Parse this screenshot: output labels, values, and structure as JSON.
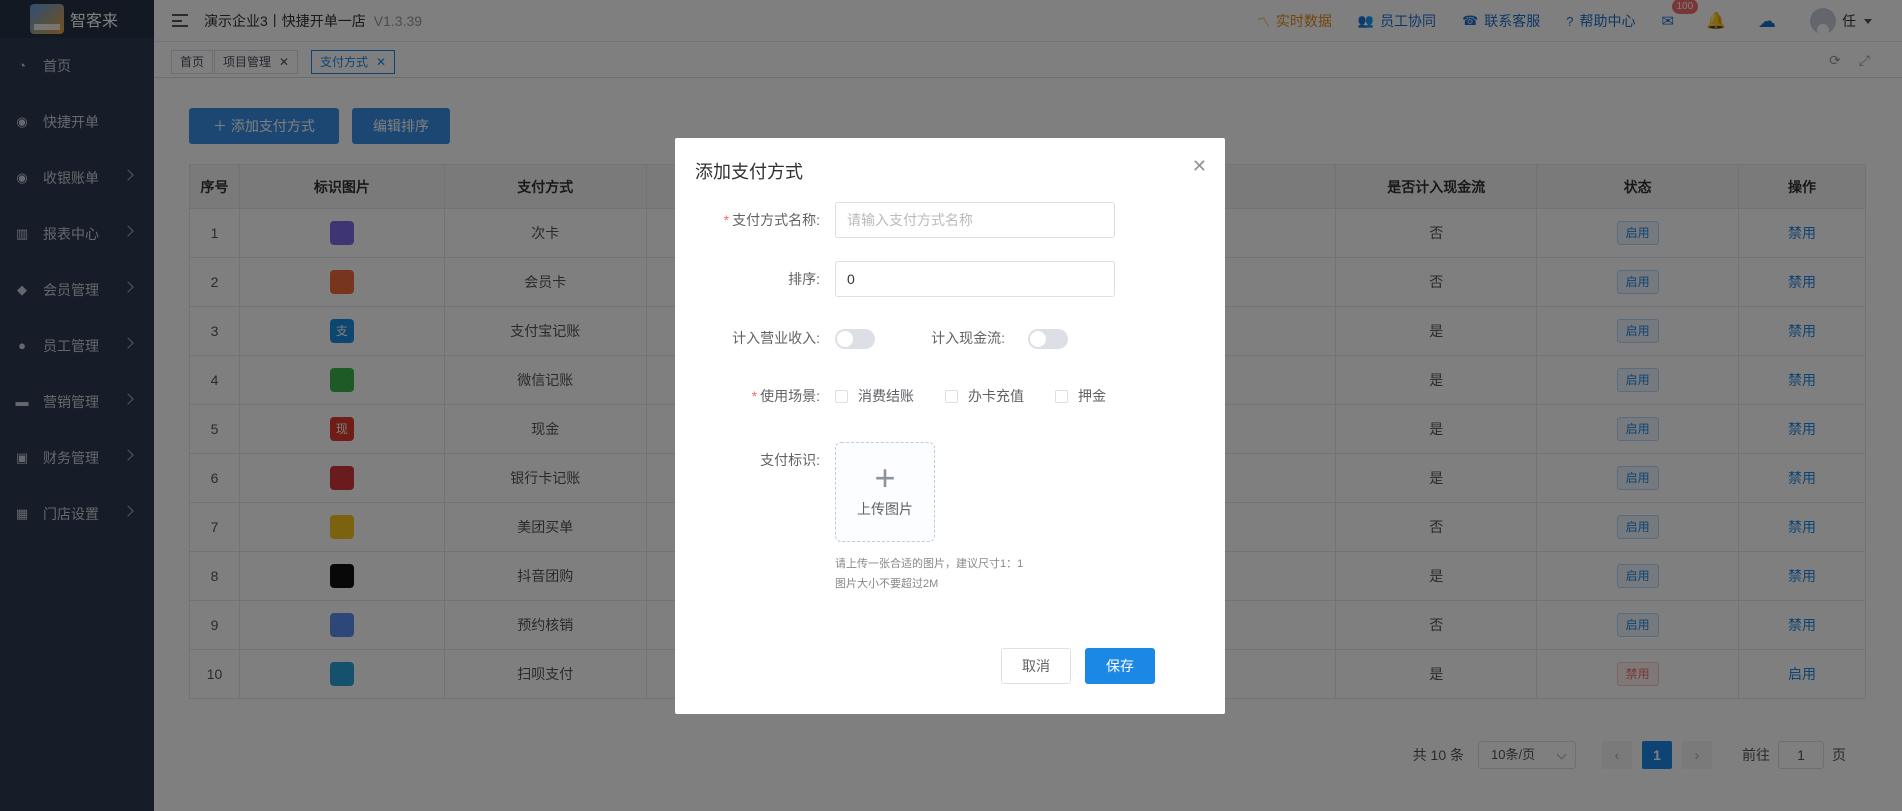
{
  "app": {
    "logo_text": "智客来",
    "company": "演示企业3丨快捷开单一店",
    "version": "V1.3.39"
  },
  "sidebar": {
    "items": [
      {
        "label": "首页",
        "icon": "dashboard-icon",
        "has_arrow": false
      },
      {
        "label": "快捷开单",
        "icon": "bag-icon",
        "has_arrow": false
      },
      {
        "label": "收银账单",
        "icon": "bag-icon",
        "has_arrow": true
      },
      {
        "label": "报表中心",
        "icon": "chart-icon",
        "has_arrow": true
      },
      {
        "label": "会员管理",
        "icon": "diamond-icon",
        "has_arrow": true
      },
      {
        "label": "员工管理",
        "icon": "user-icon",
        "has_arrow": true
      },
      {
        "label": "营销管理",
        "icon": "briefcase-icon",
        "has_arrow": true
      },
      {
        "label": "财务管理",
        "icon": "wallet-icon",
        "has_arrow": true
      },
      {
        "label": "门店设置",
        "icon": "grid-icon",
        "has_arrow": true
      }
    ]
  },
  "topbar": {
    "realtime": "实时数据",
    "collab": "员工协同",
    "service": "联系客服",
    "help": "帮助中心",
    "mail_badge": "100",
    "user": "任"
  },
  "tabs": [
    {
      "label": "首页",
      "closable": false,
      "active": false
    },
    {
      "label": "项目管理",
      "closable": true,
      "active": false
    },
    {
      "label": "支付方式",
      "closable": true,
      "active": true
    }
  ],
  "toolbar": {
    "add_label": "＋ 添加支付方式",
    "sort_label": "编辑排序"
  },
  "table": {
    "columns": [
      "序号",
      "标识图片",
      "支付方式",
      "是否计入现金流",
      "状态",
      "操作"
    ],
    "rows": [
      {
        "no": "1",
        "icon": "card-icon",
        "icon_color": "#7b6be8",
        "icon_text": "",
        "name": "次卡",
        "cash": "否",
        "status": "启用",
        "status_on": true,
        "op": "禁用"
      },
      {
        "no": "2",
        "icon": "member-card-icon",
        "icon_color": "#f06a3a",
        "icon_text": "",
        "name": "会员卡",
        "cash": "否",
        "status": "启用",
        "status_on": true,
        "op": "禁用"
      },
      {
        "no": "3",
        "icon": "alipay-icon",
        "icon_color": "#1a8ce0",
        "icon_text": "支",
        "name": "支付宝记账",
        "cash": "是",
        "status": "启用",
        "status_on": true,
        "op": "禁用"
      },
      {
        "no": "4",
        "icon": "wechat-icon",
        "icon_color": "#3bb54a",
        "icon_text": "",
        "name": "微信记账",
        "cash": "是",
        "status": "启用",
        "status_on": true,
        "op": "禁用"
      },
      {
        "no": "5",
        "icon": "cash-icon",
        "icon_color": "#e03a2e",
        "icon_text": "现",
        "name": "现金",
        "cash": "是",
        "status": "启用",
        "status_on": true,
        "op": "禁用"
      },
      {
        "no": "6",
        "icon": "unionpay-icon",
        "icon_color": "#d4363a",
        "icon_text": "",
        "name": "银行卡记账",
        "cash": "是",
        "status": "启用",
        "status_on": true,
        "op": "禁用"
      },
      {
        "no": "7",
        "icon": "meituan-icon",
        "icon_color": "#f7c51e",
        "icon_text": "",
        "name": "美团买单",
        "cash": "否",
        "status": "启用",
        "status_on": true,
        "op": "禁用"
      },
      {
        "no": "8",
        "icon": "douyin-icon",
        "icon_color": "#111111",
        "icon_text": "",
        "name": "抖音团购",
        "cash": "是",
        "status": "启用",
        "status_on": true,
        "op": "禁用"
      },
      {
        "no": "9",
        "icon": "reservation-icon",
        "icon_color": "#5b8ff0",
        "icon_text": "",
        "name": "预约核销",
        "cash": "否",
        "status": "启用",
        "status_on": true,
        "op": "禁用"
      },
      {
        "no": "10",
        "icon": "scan-pay-icon",
        "icon_color": "#2aa0d8",
        "icon_text": "",
        "name": "扫呗支付",
        "cash": "是",
        "status": "禁用",
        "status_on": false,
        "op": "启用"
      }
    ]
  },
  "pagination": {
    "total": "共 10 条",
    "page_size": "10条/页",
    "current": "1",
    "goto_prefix": "前往",
    "goto_value": "1",
    "goto_suffix": "页"
  },
  "dialog": {
    "title": "添加支付方式",
    "name_label": "支付方式名称:",
    "name_placeholder": "请输入支付方式名称",
    "sort_label": "排序:",
    "sort_value": "0",
    "revenue_label": "计入营业收入:",
    "cashflow_label": "计入现金流:",
    "scene_label": "使用场景:",
    "scenes": [
      "消费结账",
      "办卡充值",
      "押金"
    ],
    "icon_label": "支付标识:",
    "upload_text": "上传图片",
    "hint1": "请上传一张合适的图片，建议尺寸1：1",
    "hint2": "图片大小不要超过2M",
    "cancel": "取消",
    "save": "保存"
  }
}
